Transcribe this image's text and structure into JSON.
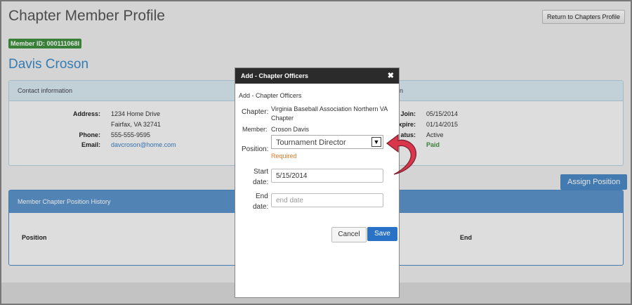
{
  "page": {
    "title": "Chapter Member Profile",
    "return_button": "Return to Chapters Profile",
    "member_id": "Member ID: 000111068I",
    "member_name": "Davis Croson"
  },
  "contact": {
    "heading": "Contact information",
    "heading_right": "n",
    "address_label": "Address:",
    "address_line1": "1234 Home Drive",
    "address_line2": "Fairfax, VA 32741",
    "phone_label": "Phone:",
    "phone": "555-555-9595",
    "email_label": "Email:",
    "email": "davcroson@home.com",
    "join_label": "Join:",
    "join_date": "05/15/2014",
    "expire_label": "xpire:",
    "expire_date": "01/14/2015",
    "status_label": "atus:",
    "status": "Active",
    "paid": "Paid"
  },
  "assign_button": "Assign Position",
  "history": {
    "heading": "Member Chapter Position History",
    "col_position": "Position",
    "col_end": "End"
  },
  "modal": {
    "title": "Add - Chapter Officers",
    "close_glyph": "✖",
    "subtitle": "Add - Chapter Officers",
    "chapter_label": "Chapter:",
    "chapter_value": "Virginia Baseball Association Northern VA Chapter",
    "member_label": "Member:",
    "member_value": "Croson Davis",
    "position_label": "Position:",
    "position_value": "Tournament Director",
    "required_text": "Required",
    "start_label_1": "Start",
    "start_label_2": "date:",
    "start_value": "5/15/2014",
    "end_label_1": "End",
    "end_label_2": "date:",
    "end_placeholder": "end date",
    "cancel": "Cancel",
    "save": "Save"
  },
  "colors": {
    "accent_blue": "#4b89c6",
    "member_id_green": "#3f8f3f",
    "required_orange": "#e67a2c",
    "arrow_red": "#d9364c"
  },
  "icons": {
    "close": "close-icon",
    "select": "chevron-down-icon",
    "callout": "curved-arrow-icon"
  }
}
